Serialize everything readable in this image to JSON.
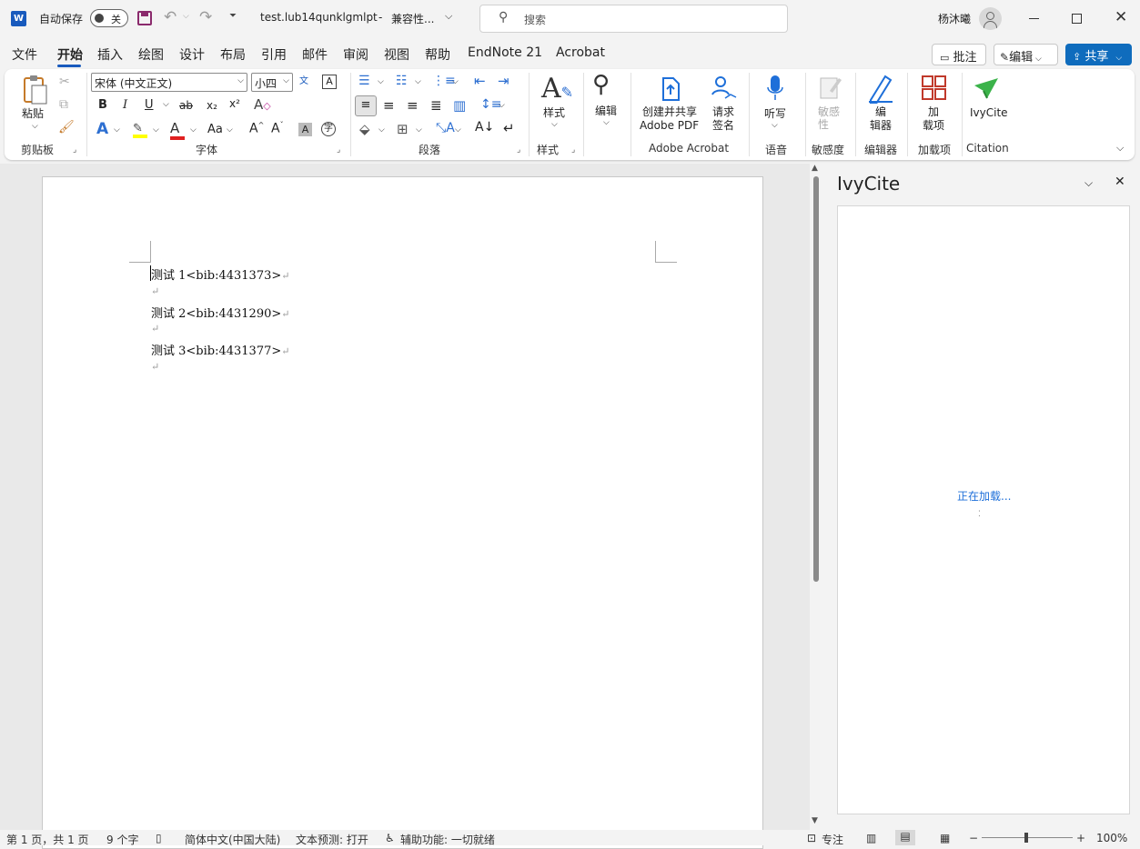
{
  "app": {
    "autosave_label": "自动保存",
    "autosave_state": "关",
    "filename": "test.lub14qunklgmlpt",
    "separator": "-",
    "compat": "兼容性...",
    "search_placeholder": "搜索",
    "user": "杨沐曦"
  },
  "tabs": [
    "文件",
    "开始",
    "插入",
    "绘图",
    "设计",
    "布局",
    "引用",
    "邮件",
    "审阅",
    "视图",
    "帮助",
    "EndNote 21",
    "Acrobat"
  ],
  "actions": {
    "comment": "批注",
    "edit": "编辑",
    "share": "共享"
  },
  "ribbon": {
    "paste": "粘贴",
    "clipboard": "剪贴板",
    "font_name": "宋体 (中文正文)",
    "font_size": "小四",
    "font_group": "字体",
    "bold": "B",
    "italic": "I",
    "underline": "U",
    "strike": "ab",
    "sub": "x₂",
    "sup": "x²",
    "case": "Aa",
    "para_group": "段落",
    "styles": "样式",
    "styles_group": "样式",
    "editing": "编辑",
    "create_share_1": "创建并共享",
    "create_share_2": "Adobe PDF",
    "request_sign_1": "请求",
    "request_sign_2": "签名",
    "acrobat_group": "Adobe Acrobat",
    "dictate": "听写",
    "voice_group": "语音",
    "sensitivity_1": "敏感",
    "sensitivity_2": "性",
    "sensitivity_group": "敏感度",
    "editor_1": "编",
    "editor_2": "辑器",
    "editor_group": "编辑器",
    "addins_1": "加",
    "addins_2": "载项",
    "addins_group": "加载项",
    "ivycite": "IvyCite",
    "citation_group": "Citation"
  },
  "document": {
    "lines": [
      "测试 1<bib:4431373>",
      "测试 2<bib:4431290>",
      "测试 3<bib:4431377>"
    ],
    "para_mark": "↵"
  },
  "pane": {
    "title": "IvyCite",
    "loading": "正在加载..."
  },
  "status": {
    "page": "第 1 页，共 1 页",
    "words": "9 个字",
    "lang": "简体中文(中国大陆)",
    "predict": "文本预测: 打开",
    "access": "辅助功能: 一切就绪",
    "focus": "专注",
    "zoom": "100%"
  },
  "colors": {
    "word_blue": "#185abd",
    "share_bg": "#0f6cbd",
    "ivy_green": "#3bb34a",
    "addins_red": "#c0392b"
  }
}
